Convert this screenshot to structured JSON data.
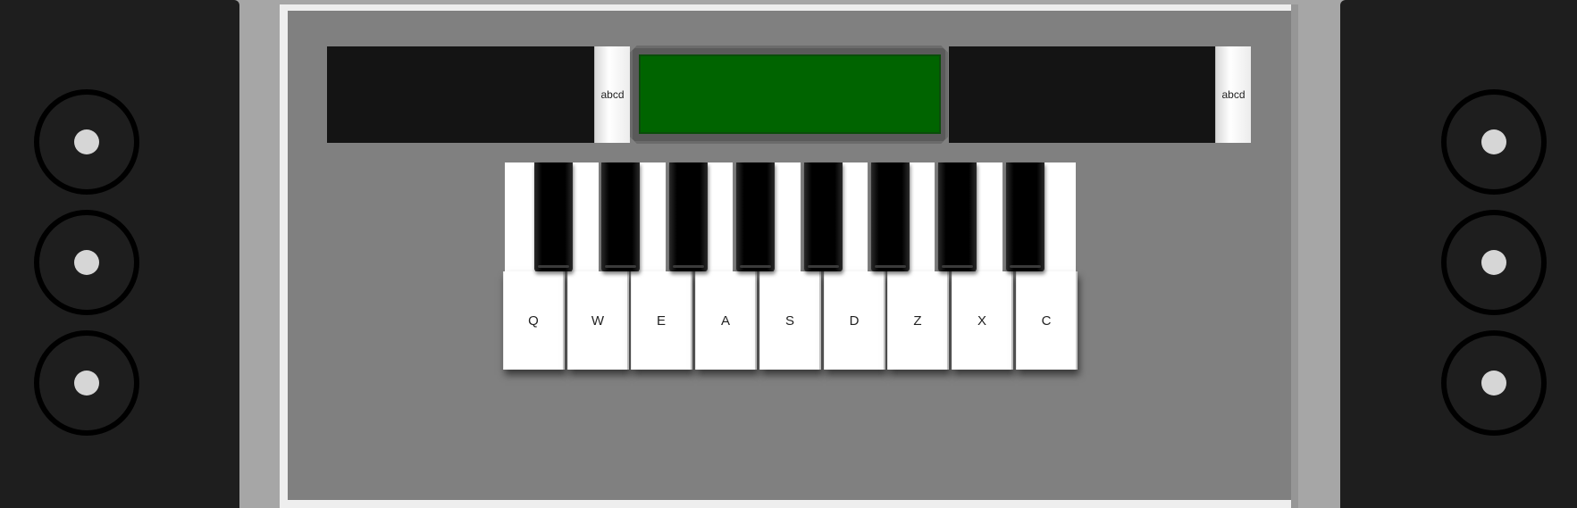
{
  "speakers": {
    "left": {
      "woofers": 3
    },
    "right": {
      "woofers": 3
    }
  },
  "controls": {
    "left_cartridge_label": "abcd",
    "right_cartridge_label": "abcd",
    "display_color": "#006400"
  },
  "keyboard": {
    "white_keys": [
      "Q",
      "W",
      "E",
      "A",
      "S",
      "D",
      "Z",
      "X",
      "C"
    ],
    "black_keys": 8
  },
  "colors": {
    "speaker": "#1e1e1e",
    "body": "#808080",
    "lcd": "#006400"
  }
}
